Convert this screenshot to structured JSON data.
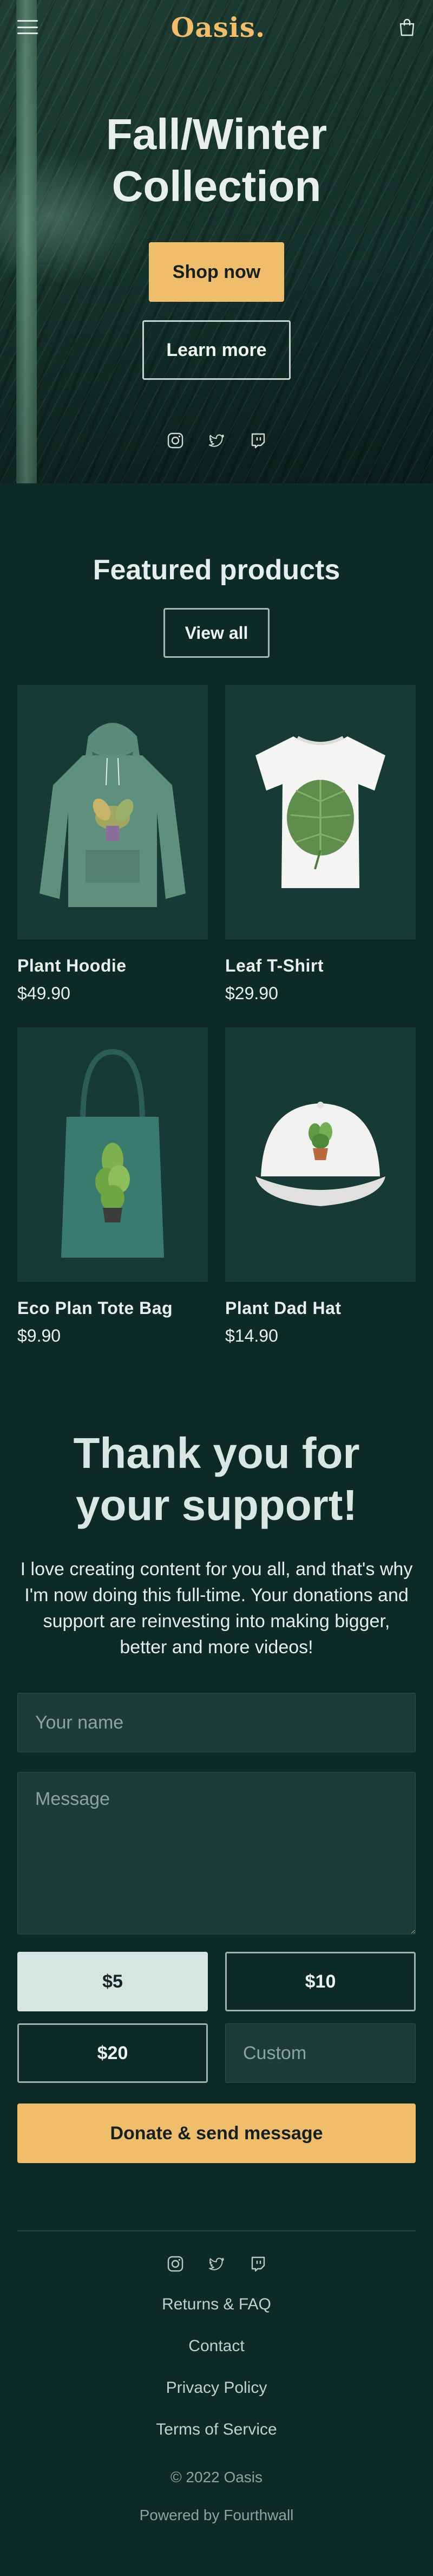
{
  "brand": {
    "logo": "Oasis."
  },
  "hero": {
    "title_line1": "Fall/Winter",
    "title_line2": "Collection",
    "shop_now": "Shop now",
    "learn_more": "Learn more"
  },
  "featured": {
    "title": "Featured products",
    "view_all": "View all",
    "products": [
      {
        "name": "Plant Hoodie",
        "price": "$49.90"
      },
      {
        "name": "Leaf T-Shirt",
        "price": "$29.90"
      },
      {
        "name": "Eco Plan Tote Bag",
        "price": "$9.90"
      },
      {
        "name": "Plant Dad Hat",
        "price": "$14.90"
      }
    ]
  },
  "support": {
    "title_line1": "Thank you for",
    "title_line2": "your support!",
    "text": "I love creating content for you all, and that's why I'm now doing this full-time. Your donations and support are reinvesting into making bigger, better and more videos!",
    "name_placeholder": "Your name",
    "message_placeholder": "Message",
    "amounts": [
      "$5",
      "$10",
      "$20"
    ],
    "selected_amount": "$5",
    "custom_placeholder": "Custom",
    "donate_button": "Donate & send message"
  },
  "footer": {
    "links": [
      "Returns & FAQ",
      "Contact",
      "Privacy Policy",
      "Terms of Service"
    ],
    "copyright": "© 2022 Oasis",
    "powered_by": "Powered by Fourthwall"
  },
  "social_icons": [
    "instagram-icon",
    "twitter-icon",
    "twitch-icon"
  ],
  "colors": {
    "background": "#0e2a27",
    "card": "#173a35",
    "accent": "#f0bd6c",
    "input": "#1d3c38",
    "selected_amount": "#d6e5e1"
  }
}
